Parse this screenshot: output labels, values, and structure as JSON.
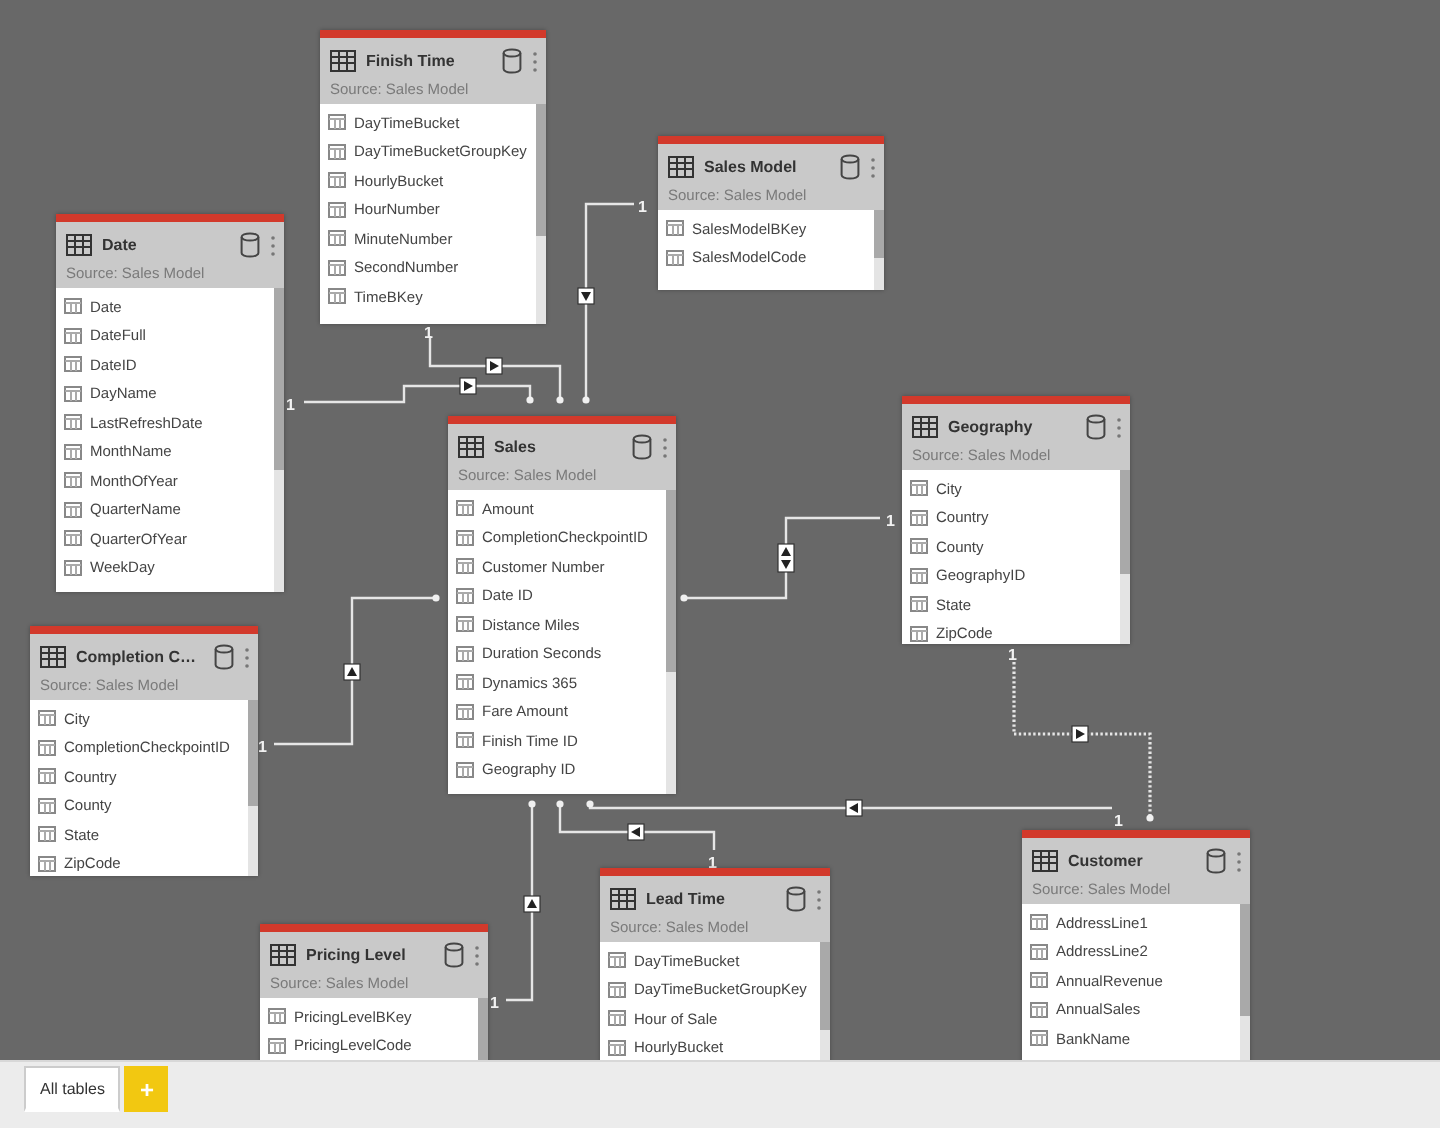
{
  "tables": [
    {
      "title": "Finish Time",
      "source": "Source: Sales Model",
      "columns": [
        "DayTimeBucket",
        "DayTimeBucketGroupKey",
        "HourlyBucket",
        "HourNumber",
        "MinuteNumber",
        "SecondNumber",
        "TimeBKey"
      ]
    },
    {
      "title": "Sales Model",
      "source": "Source: Sales Model",
      "columns": [
        "SalesModelBKey",
        "SalesModelCode"
      ]
    },
    {
      "title": "Date",
      "source": "Source: Sales Model",
      "columns": [
        "Date",
        "DateFull",
        "DateID",
        "DayName",
        "LastRefreshDate",
        "MonthName",
        "MonthOfYear",
        "QuarterName",
        "QuarterOfYear",
        "WeekDay"
      ]
    },
    {
      "title": "Sales",
      "source": "Source: Sales Model",
      "columns": [
        "Amount",
        "CompletionCheckpointID",
        "Customer Number",
        "Date ID",
        "Distance Miles",
        "Duration Seconds",
        "Dynamics 365",
        "Fare Amount",
        "Finish Time ID",
        "Geography ID"
      ]
    },
    {
      "title": "Geography",
      "source": "Source: Sales Model",
      "columns": [
        "City",
        "Country",
        "County",
        "GeographyID",
        "State",
        "ZipCode"
      ]
    },
    {
      "title": "Completion C…",
      "source": "Source: Sales Model",
      "columns": [
        "City",
        "CompletionCheckpointID",
        "Country",
        "County",
        "State",
        "ZipCode"
      ]
    },
    {
      "title": "Pricing Level",
      "source": "Source: Sales Model",
      "columns": [
        "PricingLevelBKey",
        "PricingLevelCode"
      ]
    },
    {
      "title": "Lead Time",
      "source": "Source: Sales Model",
      "columns": [
        "DayTimeBucket",
        "DayTimeBucketGroupKey",
        "Hour of Sale",
        "HourlyBucket"
      ]
    },
    {
      "title": "Customer",
      "source": "Source: Sales Model",
      "columns": [
        "AddressLine1",
        "AddressLine2",
        "AnnualRevenue",
        "AnnualSales",
        "BankName"
      ]
    }
  ],
  "relationships": [
    {
      "label": "1",
      "both_directions": false,
      "active": true
    },
    {
      "label": "1",
      "both_directions": false,
      "active": true
    },
    {
      "label": "1",
      "both_directions": false,
      "active": true
    },
    {
      "label": "1",
      "both_directions": true,
      "active": true
    },
    {
      "label": "1",
      "both_directions": false,
      "active": true
    },
    {
      "label": "1",
      "both_directions": false,
      "active": true
    },
    {
      "label": "1",
      "both_directions": false,
      "active": true
    },
    {
      "label": "1",
      "both_directions": false,
      "active": true
    },
    {
      "label": "1",
      "both_directions": false,
      "active": false
    }
  ],
  "tabs": [
    {
      "label": "All tables",
      "selected": true
    }
  ],
  "add_button": "+"
}
